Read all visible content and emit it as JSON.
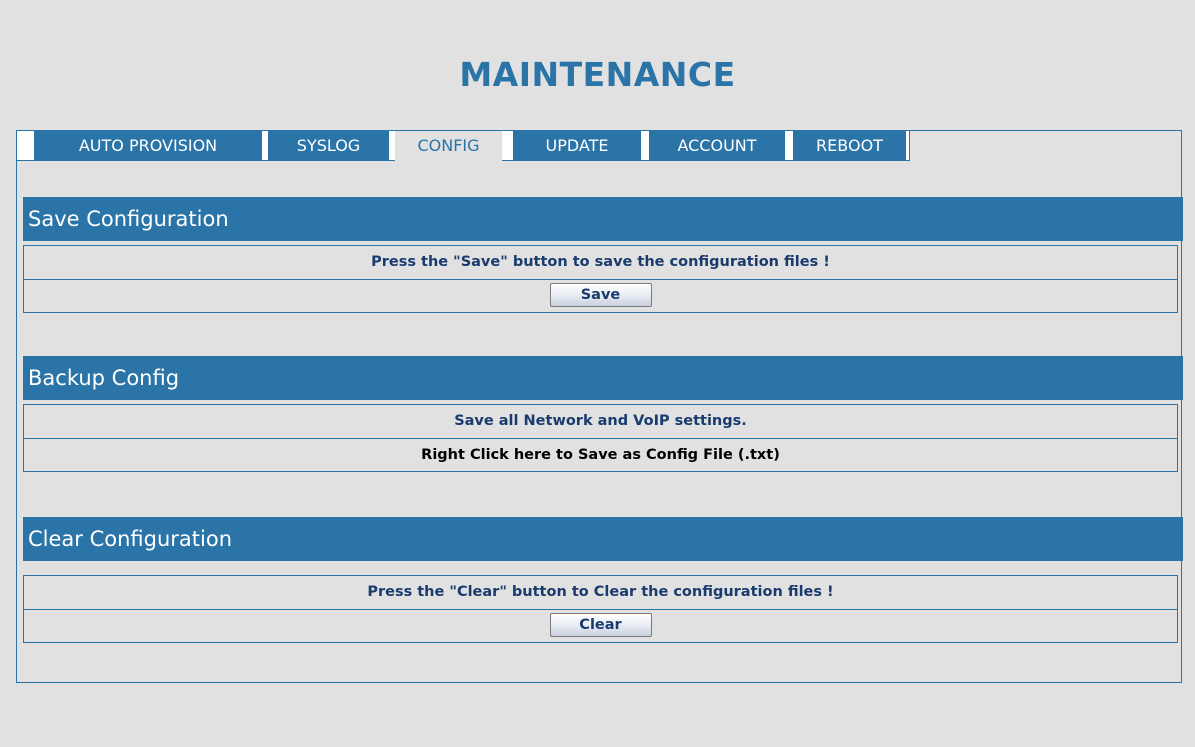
{
  "page": {
    "title": "MAINTENANCE"
  },
  "tabs": [
    {
      "label": "AUTO PROVISION",
      "active": false
    },
    {
      "label": "SYSLOG",
      "active": false
    },
    {
      "label": "CONFIG",
      "active": true
    },
    {
      "label": "UPDATE",
      "active": false
    },
    {
      "label": "ACCOUNT",
      "active": false
    },
    {
      "label": "REBOOT",
      "active": false
    }
  ],
  "save_section": {
    "title": "Save Configuration",
    "message": "Press the \"Save\" button to save the configuration files !",
    "button_label": "Save"
  },
  "backup_section": {
    "title": "Backup Config",
    "message": "Save all Network and VoIP settings.",
    "link_text": "Right Click here to Save as Config File (.txt)"
  },
  "clear_section": {
    "title": "Clear Configuration",
    "message": "Press the \"Clear\" button to Clear the configuration files !",
    "button_label": "Clear"
  },
  "colors": {
    "accent": "#2a74a8",
    "background": "#e1e1e1",
    "text_dark_blue": "#1a3b6e"
  }
}
